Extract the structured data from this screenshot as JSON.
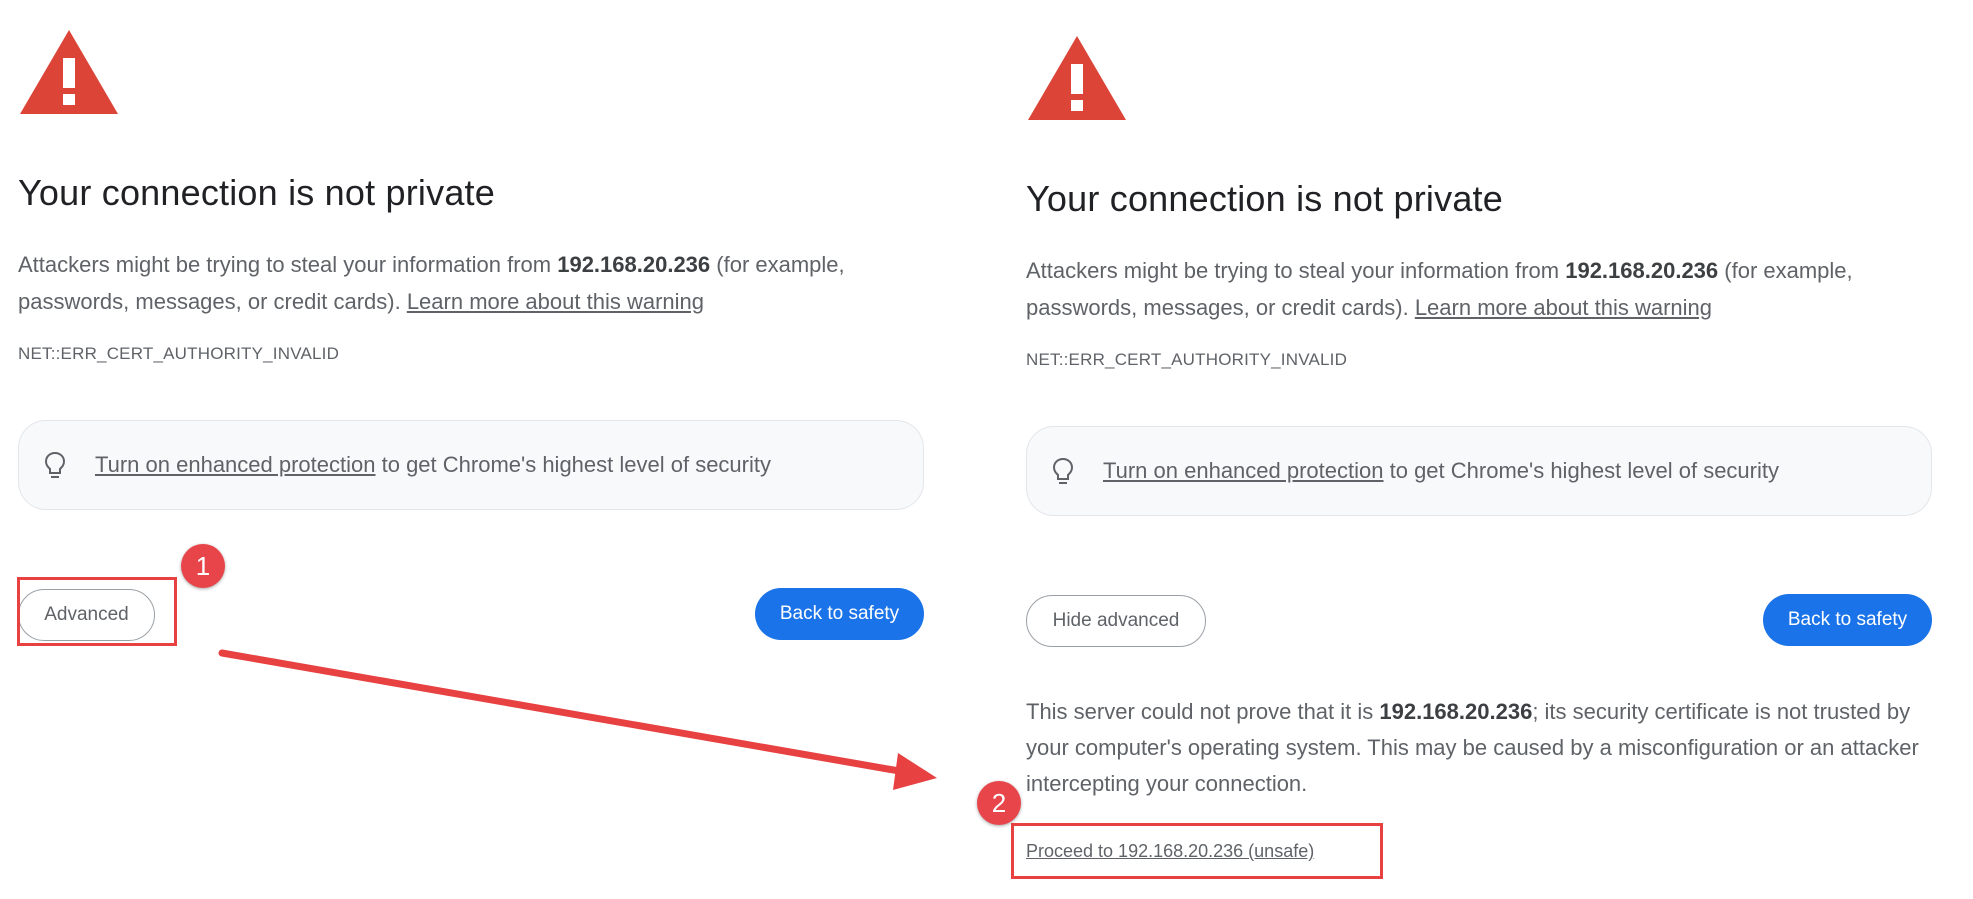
{
  "left_panel": {
    "heading": "Your connection is not private",
    "body_prefix": "Attackers might be trying to steal your information from ",
    "host": "192.168.20.236",
    "body_suffix": " (for example, passwords, messages, or credit cards). ",
    "learn_more_link": "Learn more about this warning",
    "error_code": "NET::ERR_CERT_AUTHORITY_INVALID",
    "enhanced_link": "Turn on enhanced protection",
    "enhanced_suffix": " to get Chrome's highest level of security",
    "advanced_button": "Advanced",
    "back_button": "Back to safety"
  },
  "right_panel": {
    "heading": "Your connection is not private",
    "body_prefix": "Attackers might be trying to steal your information from ",
    "host": "192.168.20.236",
    "body_suffix": " (for example, passwords, messages, or credit cards). ",
    "learn_more_link": "Learn more about this warning",
    "error_code": "NET::ERR_CERT_AUTHORITY_INVALID",
    "enhanced_link": "Turn on enhanced protection",
    "enhanced_suffix": " to get Chrome's highest level of security",
    "hide_advanced_button": "Hide advanced",
    "back_button": "Back to safety",
    "details_prefix": "This server could not prove that it is ",
    "details_host": "192.168.20.236",
    "details_suffix": "; its security certificate is not trusted by your computer's operating system. This may be caused by a misconfiguration or an attacker intercepting your connection.",
    "proceed_link": "Proceed to 192.168.20.236 (unsafe)"
  },
  "annotations": {
    "badge_1": "1",
    "badge_2": "2"
  },
  "colors": {
    "warning_red": "#db4437",
    "primary_blue": "#1a73e8",
    "annotation_red": "#e84142",
    "text_gray": "#5f6368"
  },
  "icons": [
    "warning-triangle-icon",
    "lightbulb-icon"
  ]
}
